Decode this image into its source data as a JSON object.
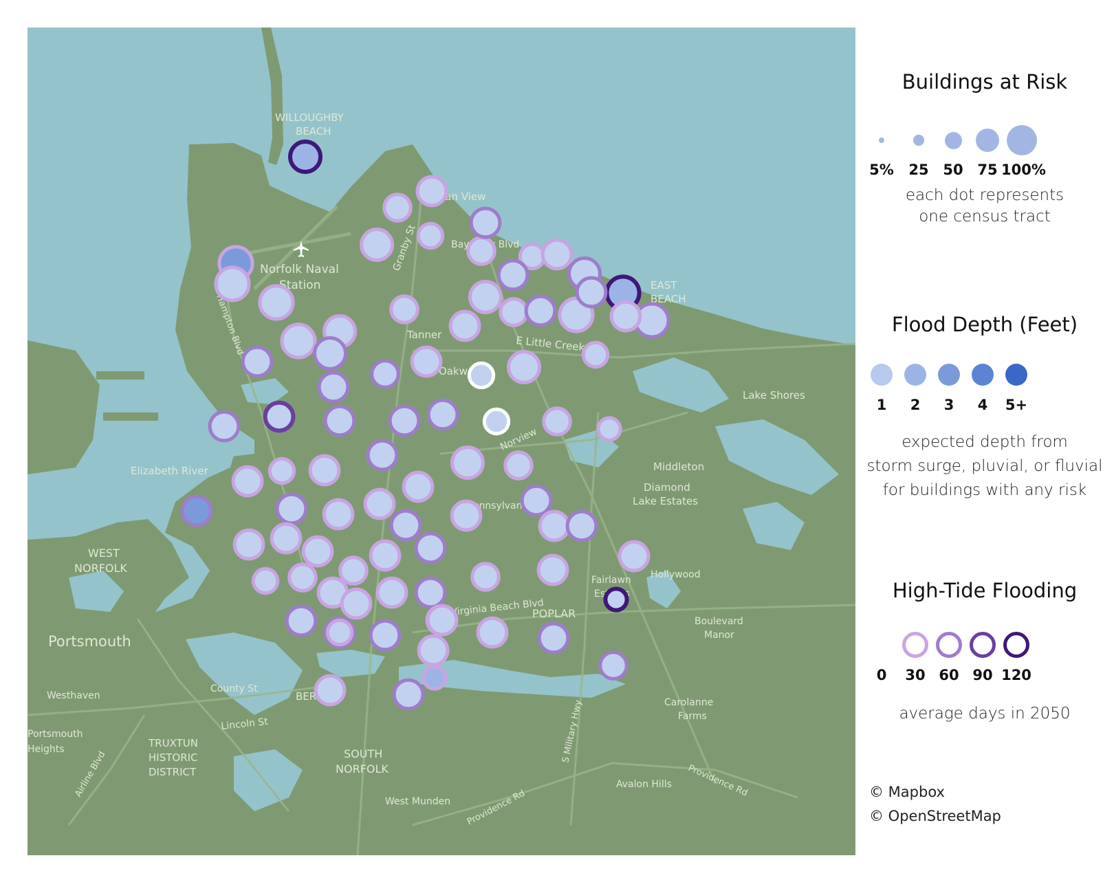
{
  "map": {
    "water_color": "#95c3cb",
    "land_color": "#7f9a72",
    "road_color": "#9ab58b",
    "labels": [
      {
        "text": "WILLOUGHBY",
        "name": "label-willoughby"
      },
      {
        "text": "BEACH",
        "name": "label-beach"
      },
      {
        "text": "Ocean View",
        "name": "label-ocean-view"
      },
      {
        "text": "Granby St",
        "name": "label-granby-st"
      },
      {
        "text": "Bay View Blvd",
        "name": "label-bay-view"
      },
      {
        "text": "Norfolk Naval",
        "name": "label-naval-1"
      },
      {
        "text": "Station",
        "name": "label-naval-2"
      },
      {
        "text": "Hampton Blvd",
        "name": "label-hampton-blvd"
      },
      {
        "text": "Tanner",
        "name": "label-tanner"
      },
      {
        "text": "E Little Creek Rd",
        "name": "label-little-creek"
      },
      {
        "text": "Oakwood",
        "name": "label-oakwood"
      },
      {
        "text": "Norview",
        "name": "label-norview"
      },
      {
        "text": "Lake Shores",
        "name": "label-lake-shores"
      },
      {
        "text": "Middleton",
        "name": "label-middleton"
      },
      {
        "text": "Diamond",
        "name": "label-diamond"
      },
      {
        "text": "Lake Estates",
        "name": "label-lake-estates"
      },
      {
        "text": "Elizabeth River",
        "name": "label-elizabeth-river"
      },
      {
        "text": "WEST",
        "name": "label-west"
      },
      {
        "text": "NORFOLK",
        "name": "label-west-norfolk"
      },
      {
        "text": "Portsmouth",
        "name": "label-portsmouth"
      },
      {
        "text": "Westhaven",
        "name": "label-westhaven"
      },
      {
        "text": "County St",
        "name": "label-county-st"
      },
      {
        "text": "Lincoln St",
        "name": "label-lincoln-st"
      },
      {
        "text": "Portsmouth",
        "name": "label-portsmouth-heights-1"
      },
      {
        "text": "Heights",
        "name": "label-portsmouth-heights-2"
      },
      {
        "text": "Airline Blvd",
        "name": "label-airline-blvd"
      },
      {
        "text": "TRUXTUN",
        "name": "label-truxtun-1"
      },
      {
        "text": "HISTORIC",
        "name": "label-truxtun-2"
      },
      {
        "text": "DISTRICT",
        "name": "label-truxtun-3"
      },
      {
        "text": "SOUTH",
        "name": "label-south"
      },
      {
        "text": "NORFOLK",
        "name": "label-south-norfolk"
      },
      {
        "text": "BERKLEY",
        "name": "label-berkley"
      },
      {
        "text": "West Munden",
        "name": "label-west-munden"
      },
      {
        "text": "Providence Rd",
        "name": "label-providence-rd-1"
      },
      {
        "text": "Providence Rd",
        "name": "label-providence-rd-2"
      },
      {
        "text": "S Military Hwy",
        "name": "label-military-hwy"
      },
      {
        "text": "Avalon Hills",
        "name": "label-avalon-hills"
      },
      {
        "text": "Carolanne",
        "name": "label-carolanne"
      },
      {
        "text": "Farms",
        "name": "label-farms"
      },
      {
        "text": "Boulevard",
        "name": "label-boulevard"
      },
      {
        "text": "Manor",
        "name": "label-manor"
      },
      {
        "text": "Hollywood",
        "name": "label-hollywood"
      },
      {
        "text": "Fairlawn",
        "name": "label-fairlawn"
      },
      {
        "text": "Estates",
        "name": "label-estates"
      },
      {
        "text": "POPLAR",
        "name": "label-poplar"
      },
      {
        "text": "Virginia Beach Blvd",
        "name": "label-virginia-beach-blvd"
      },
      {
        "text": "Pennsylvania",
        "name": "label-pennsylvania"
      },
      {
        "text": "EAST",
        "name": "label-east"
      },
      {
        "text": "BEACH",
        "name": "label-east-beach"
      }
    ]
  },
  "tract_dots": [
    {
      "buildings_pct": 50,
      "depth_ft": 2,
      "tide_days": 120
    },
    {
      "buildings_pct": 40,
      "depth_ft": 1,
      "tide_days": 30
    },
    {
      "buildings_pct": 40,
      "depth_ft": 1,
      "tide_days": 30
    },
    {
      "buildings_pct": 35,
      "depth_ft": 1,
      "tide_days": 30
    },
    {
      "buildings_pct": 50,
      "depth_ft": 1,
      "tide_days": 30
    },
    {
      "buildings_pct": 35,
      "depth_ft": 1,
      "tide_days": 30
    },
    {
      "buildings_pct": 40,
      "depth_ft": 1,
      "tide_days": 30
    },
    {
      "buildings_pct": 35,
      "depth_ft": 1,
      "tide_days": 30
    },
    {
      "buildings_pct": 50,
      "depth_ft": 1,
      "tide_days": 60
    },
    {
      "buildings_pct": 55,
      "depth_ft": 3,
      "tide_days": 30
    },
    {
      "buildings_pct": 55,
      "depth_ft": 1,
      "tide_days": 30
    },
    {
      "buildings_pct": 55,
      "depth_ft": 1,
      "tide_days": 30
    },
    {
      "buildings_pct": 40,
      "depth_ft": 1,
      "tide_days": 30
    },
    {
      "buildings_pct": 55,
      "depth_ft": 2,
      "tide_days": 120
    },
    {
      "buildings_pct": 55,
      "depth_ft": 1,
      "tide_days": 60
    },
    {
      "buildings_pct": 40,
      "depth_ft": 1,
      "tide_days": 30
    },
    {
      "buildings_pct": 50,
      "depth_ft": 1,
      "tide_days": 30
    },
    {
      "buildings_pct": 45,
      "depth_ft": 1,
      "tide_days": 60
    },
    {
      "buildings_pct": 55,
      "depth_ft": 1,
      "tide_days": 30
    },
    {
      "buildings_pct": 45,
      "depth_ft": 1,
      "tide_days": 30
    },
    {
      "buildings_pct": 45,
      "depth_ft": 1,
      "tide_days": 30
    },
    {
      "buildings_pct": 55,
      "depth_ft": 1,
      "tide_days": 30
    },
    {
      "buildings_pct": 50,
      "depth_ft": 1,
      "tide_days": 30
    },
    {
      "buildings_pct": 50,
      "depth_ft": 1,
      "tide_days": 60
    },
    {
      "buildings_pct": 45,
      "depth_ft": 1,
      "tide_days": 30
    },
    {
      "buildings_pct": 35,
      "depth_ft": 1,
      "tide_days": 0
    },
    {
      "buildings_pct": 35,
      "depth_ft": 1,
      "tide_days": 30
    },
    {
      "buildings_pct": 50,
      "depth_ft": 1,
      "tide_days": 30
    },
    {
      "buildings_pct": 45,
      "depth_ft": 1,
      "tide_days": 60
    },
    {
      "buildings_pct": 45,
      "depth_ft": 1,
      "tide_days": 90
    },
    {
      "buildings_pct": 45,
      "depth_ft": 1,
      "tide_days": 60
    },
    {
      "buildings_pct": 45,
      "depth_ft": 1,
      "tide_days": 60
    },
    {
      "buildings_pct": 40,
      "depth_ft": 1,
      "tide_days": 60
    },
    {
      "buildings_pct": 35,
      "depth_ft": 1,
      "tide_days": 0
    },
    {
      "buildings_pct": 40,
      "depth_ft": 1,
      "tide_days": 30
    },
    {
      "buildings_pct": 30,
      "depth_ft": 1,
      "tide_days": 30
    },
    {
      "buildings_pct": 45,
      "depth_ft": 1,
      "tide_days": 60
    },
    {
      "buildings_pct": 45,
      "depth_ft": 1,
      "tide_days": 60
    },
    {
      "buildings_pct": 45,
      "depth_ft": 1,
      "tide_days": 60
    },
    {
      "buildings_pct": 45,
      "depth_ft": 1,
      "tide_days": 60
    },
    {
      "buildings_pct": 35,
      "depth_ft": 1,
      "tide_days": 30
    },
    {
      "buildings_pct": 45,
      "depth_ft": 1,
      "tide_days": 30
    },
    {
      "buildings_pct": 45,
      "depth_ft": 1,
      "tide_days": 30
    },
    {
      "buildings_pct": 45,
      "depth_ft": 1,
      "tide_days": 60
    },
    {
      "buildings_pct": 45,
      "depth_ft": 3,
      "tide_days": 60
    },
    {
      "buildings_pct": 45,
      "depth_ft": 1,
      "tide_days": 30
    },
    {
      "buildings_pct": 45,
      "depth_ft": 1,
      "tide_days": 30
    },
    {
      "buildings_pct": 45,
      "depth_ft": 1,
      "tide_days": 30
    },
    {
      "buildings_pct": 50,
      "depth_ft": 1,
      "tide_days": 30
    },
    {
      "buildings_pct": 40,
      "depth_ft": 1,
      "tide_days": 30
    },
    {
      "buildings_pct": 45,
      "depth_ft": 1,
      "tide_days": 60
    },
    {
      "buildings_pct": 45,
      "depth_ft": 1,
      "tide_days": 60
    },
    {
      "buildings_pct": 45,
      "depth_ft": 1,
      "tide_days": 30
    },
    {
      "buildings_pct": 45,
      "depth_ft": 1,
      "tide_days": 30
    },
    {
      "buildings_pct": 45,
      "depth_ft": 1,
      "tide_days": 30
    },
    {
      "buildings_pct": 45,
      "depth_ft": 1,
      "tide_days": 30
    },
    {
      "buildings_pct": 45,
      "depth_ft": 1,
      "tide_days": 30
    },
    {
      "buildings_pct": 40,
      "depth_ft": 1,
      "tide_days": 30
    },
    {
      "buildings_pct": 45,
      "depth_ft": 1,
      "tide_days": 30
    },
    {
      "buildings_pct": 45,
      "depth_ft": 1,
      "tide_days": 60
    },
    {
      "buildings_pct": 45,
      "depth_ft": 1,
      "tide_days": 60
    },
    {
      "buildings_pct": 45,
      "depth_ft": 1,
      "tide_days": 30
    },
    {
      "buildings_pct": 45,
      "depth_ft": 1,
      "tide_days": 30
    },
    {
      "buildings_pct": 35,
      "depth_ft": 1,
      "tide_days": 30
    },
    {
      "buildings_pct": 40,
      "depth_ft": 1,
      "tide_days": 30
    },
    {
      "buildings_pct": 45,
      "depth_ft": 1,
      "tide_days": 30
    },
    {
      "buildings_pct": 45,
      "depth_ft": 1,
      "tide_days": 60
    },
    {
      "buildings_pct": 45,
      "depth_ft": 1,
      "tide_days": 60
    },
    {
      "buildings_pct": 45,
      "depth_ft": 1,
      "tide_days": 60
    },
    {
      "buildings_pct": 45,
      "depth_ft": 1,
      "tide_days": 30
    },
    {
      "buildings_pct": 45,
      "depth_ft": 1,
      "tide_days": 30
    },
    {
      "buildings_pct": 45,
      "depth_ft": 1,
      "tide_days": 30
    },
    {
      "buildings_pct": 40,
      "depth_ft": 1,
      "tide_days": 30
    },
    {
      "buildings_pct": 45,
      "depth_ft": 1,
      "tide_days": 30
    },
    {
      "buildings_pct": 45,
      "depth_ft": 1,
      "tide_days": 30
    },
    {
      "buildings_pct": 30,
      "depth_ft": 1,
      "tide_days": 120
    },
    {
      "buildings_pct": 30,
      "depth_ft": 2,
      "tide_days": 30
    },
    {
      "buildings_pct": 45,
      "depth_ft": 1,
      "tide_days": 30
    },
    {
      "buildings_pct": 40,
      "depth_ft": 1,
      "tide_days": 60
    },
    {
      "buildings_pct": 35,
      "depth_ft": 1,
      "tide_days": 30
    },
    {
      "buildings_pct": 45,
      "depth_ft": 1,
      "tide_days": 60
    },
    {
      "buildings_pct": 40,
      "depth_ft": 1,
      "tide_days": 60
    },
    {
      "buildings_pct": 45,
      "depth_ft": 1,
      "tide_days": 60
    },
    {
      "buildings_pct": 45,
      "depth_ft": 1,
      "tide_days": 60
    },
    {
      "buildings_pct": 35,
      "depth_ft": 1,
      "tide_days": 30
    },
    {
      "buildings_pct": 45,
      "depth_ft": 1,
      "tide_days": 30
    },
    {
      "buildings_pct": 45,
      "depth_ft": 1,
      "tide_days": 30
    },
    {
      "buildings_pct": 45,
      "depth_ft": 1,
      "tide_days": 60
    },
    {
      "buildings_pct": 45,
      "depth_ft": 1,
      "tide_days": 60
    },
    {
      "buildings_pct": 45,
      "depth_ft": 1,
      "tide_days": 30
    },
    {
      "buildings_pct": 45,
      "depth_ft": 1,
      "tide_days": 60
    }
  ],
  "legend": {
    "buildings": {
      "title": "Buildings at Risk",
      "sizes": [
        {
          "label": "5%",
          "pct": 5
        },
        {
          "label": "25",
          "pct": 25
        },
        {
          "label": "50",
          "pct": 50
        },
        {
          "label": "75",
          "pct": 75
        },
        {
          "label": "100%",
          "pct": 100
        }
      ],
      "note_line1": "each dot represents",
      "note_line2": "one census tract"
    },
    "depth": {
      "title": "Flood Depth (Feet)",
      "levels": [
        {
          "label": "1",
          "color": "#b7c9ec"
        },
        {
          "label": "2",
          "color": "#9cb4e5"
        },
        {
          "label": "3",
          "color": "#7b9ad9"
        },
        {
          "label": "4",
          "color": "#5b84d2"
        },
        {
          "label": "5+",
          "color": "#3b68c7"
        }
      ],
      "note_line1": "expected depth from",
      "note_line2": "storm surge, pluvial, or fluvial",
      "note_line3": "for buildings with any risk"
    },
    "tide": {
      "title": "High-Tide Flooding",
      "levels": [
        {
          "label": "0",
          "color": "#ffffff"
        },
        {
          "label": "30",
          "color": "#c9a4e3"
        },
        {
          "label": "60",
          "color": "#9f7ccc"
        },
        {
          "label": "90",
          "color": "#6a3f9e"
        },
        {
          "label": "120",
          "color": "#3f1779"
        }
      ],
      "note": "average days in 2050"
    }
  },
  "credits": {
    "mapbox": "© Mapbox",
    "osm": "© OpenStreetMap"
  }
}
